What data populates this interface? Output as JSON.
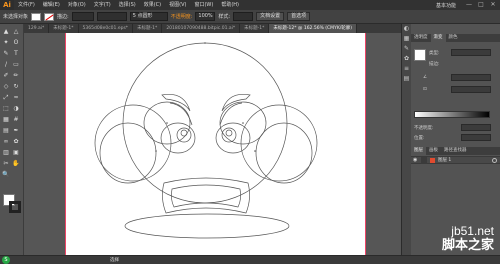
{
  "app": {
    "logo": "Ai"
  },
  "menubar": {
    "items": [
      "文件(F)",
      "编辑(E)",
      "对象(O)",
      "文字(T)",
      "选择(S)",
      "效果(C)",
      "视图(V)",
      "窗口(W)",
      "帮助(H)"
    ],
    "workspace": "基本功能",
    "window_buttons": [
      "—",
      "□",
      "✕"
    ]
  },
  "controlbar": {
    "selection_label": "未选择对象",
    "stroke_label": "描边:",
    "stroke_weight": "",
    "point_label": "5 点圆形",
    "opacity_label": "不透明度:",
    "opacity_value": "100%",
    "style_label": "样式:",
    "document_setup": "文档设置",
    "preferences": "首选项"
  },
  "tabs": [
    {
      "label": "129.ai*",
      "active": false
    },
    {
      "label": "未标题-1*",
      "active": false
    },
    {
      "label": "5365d08e0c01.eps*",
      "active": false
    },
    {
      "label": "未标题-1*",
      "active": false
    },
    {
      "label": "20180107090488.bitpic.01.ai*",
      "active": false
    },
    {
      "label": "未标题-1*",
      "active": false
    },
    {
      "label": "未标题-12* @ 162.56% (CMYK/轮廓)",
      "active": true
    }
  ],
  "tools": {
    "icons": [
      "selection-icon",
      "direct-selection-icon",
      "magic-wand-icon",
      "lasso-icon",
      "pen-icon",
      "type-icon",
      "line-icon",
      "rectangle-icon",
      "paintbrush-icon",
      "pencil-icon",
      "eraser-icon",
      "rotate-icon",
      "scale-icon",
      "width-icon",
      "free-transform-icon",
      "shape-builder-icon",
      "perspective-icon",
      "mesh-icon",
      "gradient-icon",
      "eyedropper-icon",
      "blend-icon",
      "symbol-sprayer-icon",
      "graph-icon",
      "artboard-icon",
      "slice-icon",
      "hand-icon",
      "zoom-icon"
    ],
    "glyphs": [
      "▲",
      "△",
      "✦",
      "ʘ",
      "✎",
      "T",
      "/",
      "▭",
      "✐",
      "✏",
      "◇",
      "↻",
      "⤢",
      "≈",
      "⬚",
      "◑",
      "▦",
      "#",
      "▤",
      "✒",
      "∞",
      "✿",
      "▥",
      "▣",
      "✂",
      "✋",
      "🔍"
    ]
  },
  "gradient_panel": {
    "tabs": [
      "透明度",
      "渐变",
      "颜色"
    ],
    "active_tab": "渐变",
    "type_label": "类型:",
    "stroke_label": "描边:",
    "angle_label": "角度",
    "ratio_label": "",
    "opacity_label": "不透明度:",
    "location_label": "位置:"
  },
  "layers_panel": {
    "tabs": [
      "图层",
      "画板",
      "路径查找器"
    ],
    "active_tab": "图层",
    "layer_name": "图层 1",
    "layer_color": "#e14b2f"
  },
  "statusbar": {
    "tool_name": "选择"
  },
  "watermark": {
    "site": "jb51.net",
    "cn": "脚本之家"
  },
  "colors": {
    "artboard_border": "#ee4466",
    "outline_stroke": "#555555"
  }
}
